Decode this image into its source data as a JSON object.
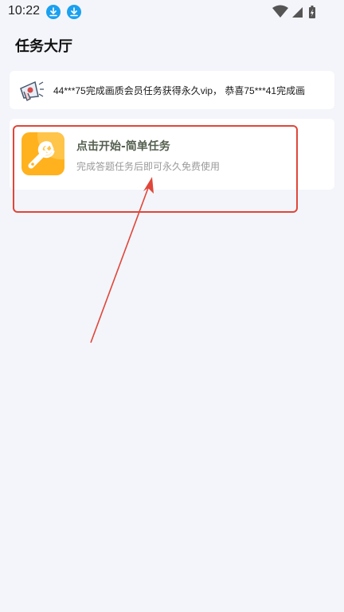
{
  "status_bar": {
    "time": "10:22",
    "notification_icons": [
      "download-icon",
      "download-icon"
    ],
    "system_icons": [
      "wifi-icon",
      "cellular-signal-icon",
      "battery-charging-icon"
    ]
  },
  "page": {
    "title": "任务大厅"
  },
  "announcement": {
    "icon": "megaphone-icon",
    "text": "44***75完成画质会员任务获得永久vip， 恭喜75***41完成画"
  },
  "task": {
    "icon": "wrench-icon",
    "icon_color": "#ffb21e",
    "title": "点击开始-简单任务",
    "subtitle": "完成答题任务后即可永久免费使用"
  },
  "annotation": {
    "color": "#e0463a"
  }
}
